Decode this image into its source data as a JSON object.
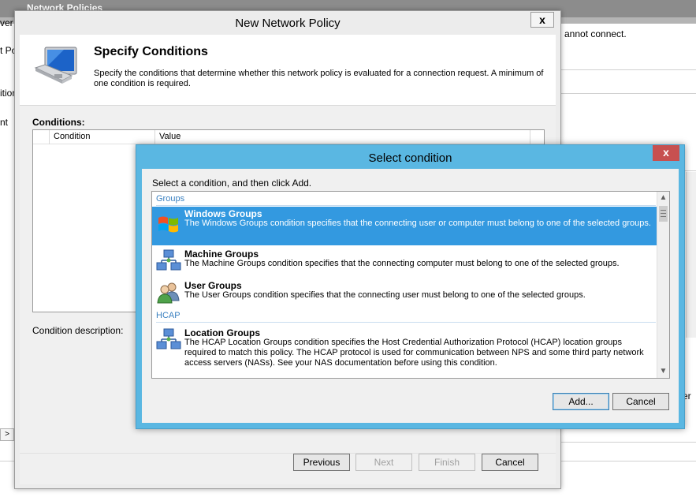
{
  "background": {
    "title": "Network Policies",
    "left_fragments": [
      "ver",
      "t Po",
      "ition",
      "nt"
    ],
    "right_text": "annot connect.",
    "right_letter": "er",
    "scroll_arrow": ">"
  },
  "policy_dialog": {
    "title": "New Network Policy",
    "close_glyph": "x",
    "header_title": "Specify Conditions",
    "header_desc": "Specify the conditions that determine whether this network policy is evaluated for a connection request. A minimum of one condition is required.",
    "conditions_label": "Conditions:",
    "columns": [
      "Condition",
      "Value"
    ],
    "condition_description_label": "Condition description:",
    "buttons": {
      "previous": "Previous",
      "next": "Next",
      "finish": "Finish",
      "cancel": "Cancel"
    }
  },
  "select_dialog": {
    "title": "Select condition",
    "close_glyph": "x",
    "instruction": "Select a condition, and then click Add.",
    "groups": [
      {
        "label": "Groups",
        "items": [
          {
            "name": "Windows Groups",
            "description": "The Windows Groups condition specifies that the connecting user or computer must belong to one of the selected groups.",
            "icon": "windows-flag-icon",
            "selected": true
          },
          {
            "name": "Machine Groups",
            "description": "The Machine Groups condition specifies that the connecting computer must belong to one of the selected groups.",
            "icon": "network-computers-icon",
            "selected": false
          },
          {
            "name": "User Groups",
            "description": "The User Groups condition specifies that the connecting user must belong to one of the selected groups.",
            "icon": "users-icon",
            "selected": false
          }
        ]
      },
      {
        "label": "HCAP",
        "items": [
          {
            "name": "Location Groups",
            "description": "The HCAP Location Groups condition specifies the Host Credential Authorization Protocol (HCAP) location groups required to match this policy. The HCAP protocol is used for communication between NPS and some third party network access servers (NASs). See your NAS documentation before using this condition.",
            "icon": "network-computers-icon",
            "selected": false
          }
        ]
      }
    ],
    "buttons": {
      "add": "Add...",
      "cancel": "Cancel"
    }
  },
  "colors": {
    "selection": "#3399e0",
    "dialog_frame": "#5ab7e2",
    "close_button": "#c75050",
    "group_heading": "#3a80c0"
  }
}
